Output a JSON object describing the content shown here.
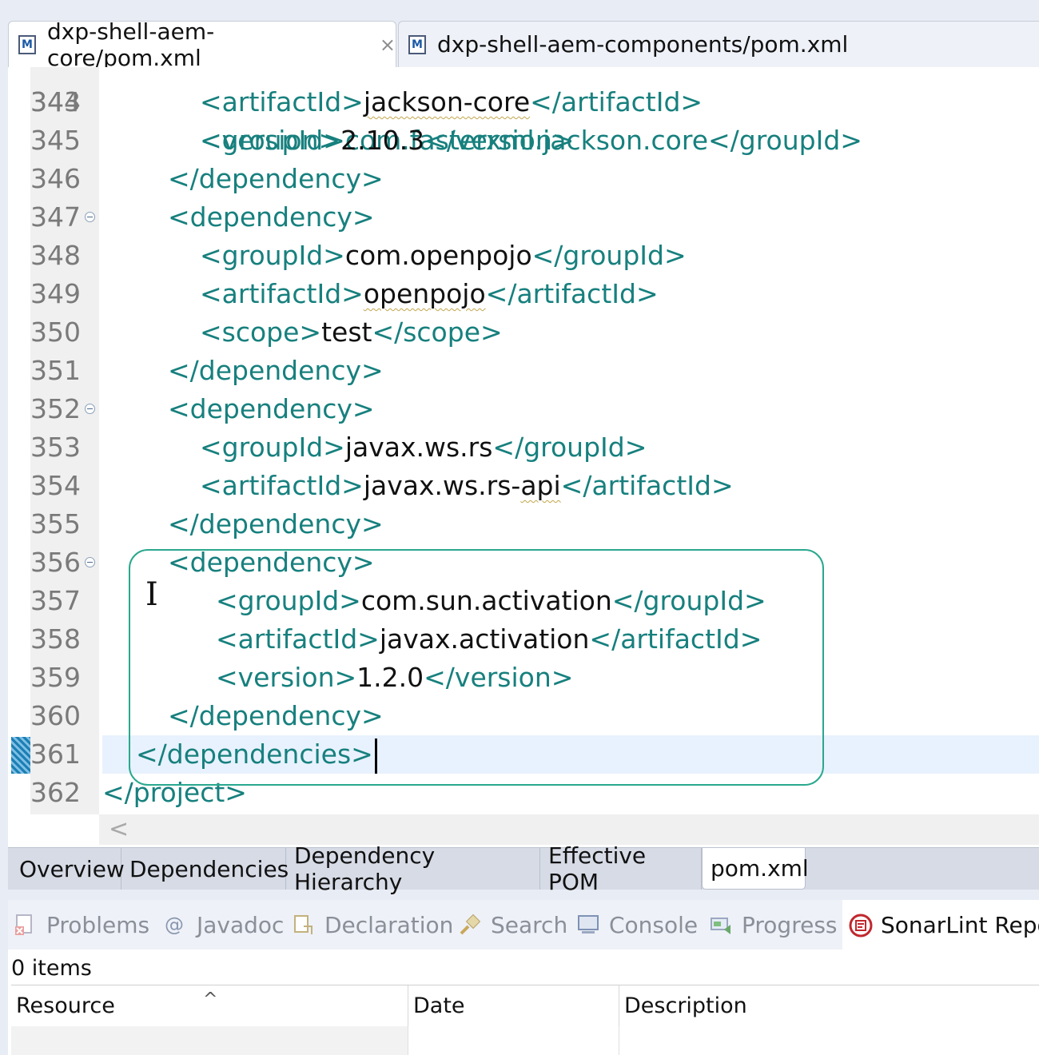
{
  "tabs": [
    {
      "label": "dxp-shell-aem-core/pom.xml",
      "active": true
    },
    {
      "label": "dxp-shell-aem-components/pom.xml",
      "active": false
    }
  ],
  "tab_icon_letter": "M",
  "editor": {
    "partial_line_text": "<groupId>com.fasterxml.jackson.core</groupId>",
    "lines": [
      {
        "n": "344",
        "indent": 3,
        "parts": [
          [
            "t",
            "<artifactId>"
          ],
          [
            "x",
            "jackson-core",
            "s"
          ],
          [
            "t",
            "</artifactId>"
          ]
        ]
      },
      {
        "n": "345",
        "indent": 3,
        "parts": [
          [
            "t",
            "<version>"
          ],
          [
            "x",
            "2.10.3"
          ],
          [
            "t",
            "</version>"
          ]
        ]
      },
      {
        "n": "346",
        "indent": 2,
        "parts": [
          [
            "t",
            "</dependency>"
          ]
        ]
      },
      {
        "n": "347",
        "indent": 2,
        "fold": true,
        "parts": [
          [
            "t",
            "<dependency>"
          ]
        ]
      },
      {
        "n": "348",
        "indent": 3,
        "parts": [
          [
            "t",
            "<groupId>"
          ],
          [
            "x",
            "com.openpojo"
          ],
          [
            "t",
            "</groupId>"
          ]
        ]
      },
      {
        "n": "349",
        "indent": 3,
        "parts": [
          [
            "t",
            "<artifactId>"
          ],
          [
            "x",
            "openpojo",
            "s"
          ],
          [
            "t",
            "</artifactId>"
          ]
        ]
      },
      {
        "n": "350",
        "indent": 3,
        "parts": [
          [
            "t",
            "<scope>"
          ],
          [
            "x",
            "test"
          ],
          [
            "t",
            "</scope>"
          ]
        ]
      },
      {
        "n": "351",
        "indent": 2,
        "parts": [
          [
            "t",
            "</dependency>"
          ]
        ]
      },
      {
        "n": "352",
        "indent": 2,
        "fold": true,
        "parts": [
          [
            "t",
            "<dependency>"
          ]
        ]
      },
      {
        "n": "353",
        "indent": 3,
        "parts": [
          [
            "t",
            "<groupId>"
          ],
          [
            "x",
            "javax.ws.rs"
          ],
          [
            "t",
            "</groupId>"
          ]
        ]
      },
      {
        "n": "354",
        "indent": 3,
        "parts": [
          [
            "t",
            "<artifactId>"
          ],
          [
            "x",
            "javax.ws.rs-"
          ],
          [
            "x",
            "api",
            "s"
          ],
          [
            "t",
            "</artifactId>"
          ]
        ]
      },
      {
        "n": "355",
        "indent": 2,
        "parts": [
          [
            "t",
            "</dependency>"
          ]
        ]
      },
      {
        "n": "356",
        "indent": 2,
        "fold": true,
        "parts": [
          [
            "t",
            "<dependency>"
          ]
        ]
      },
      {
        "n": "357",
        "indent": 4,
        "parts": [
          [
            "t",
            "<groupId>"
          ],
          [
            "x",
            "com.sun.activation"
          ],
          [
            "t",
            "</groupId>"
          ]
        ]
      },
      {
        "n": "358",
        "indent": 4,
        "parts": [
          [
            "t",
            "<artifactId>"
          ],
          [
            "x",
            "javax.activation"
          ],
          [
            "t",
            "</artifactId>"
          ]
        ]
      },
      {
        "n": "359",
        "indent": 4,
        "parts": [
          [
            "t",
            "<version>"
          ],
          [
            "x",
            "1.2.0"
          ],
          [
            "t",
            "</version>"
          ]
        ]
      },
      {
        "n": "360",
        "indent": 2,
        "parts": [
          [
            "t",
            "</dependency>"
          ]
        ]
      },
      {
        "n": "361",
        "indent": 1,
        "current": true,
        "caret": true,
        "parts": [
          [
            "t",
            "</dependencies>"
          ]
        ]
      },
      {
        "n": "362",
        "indent": 0,
        "parts": [
          [
            "t",
            "</project>"
          ]
        ]
      }
    ]
  },
  "page_tabs": [
    {
      "label": "Overview",
      "active": false
    },
    {
      "label": "Dependencies",
      "active": false
    },
    {
      "label": "Dependency Hierarchy",
      "active": false
    },
    {
      "label": "Effective POM",
      "active": false
    },
    {
      "label": "pom.xml",
      "active": true
    }
  ],
  "view_tabs": [
    {
      "label": "Problems",
      "icon": "problems-icon",
      "active": false
    },
    {
      "label": "Javadoc",
      "icon": "javadoc-icon",
      "active": false
    },
    {
      "label": "Declaration",
      "icon": "declaration-icon",
      "active": false
    },
    {
      "label": "Search",
      "icon": "search-icon",
      "active": false
    },
    {
      "label": "Console",
      "icon": "console-icon",
      "active": false
    },
    {
      "label": "Progress",
      "icon": "progress-icon",
      "active": false
    },
    {
      "label": "SonarLint Repo",
      "icon": "sonarlint-icon",
      "active": true
    }
  ],
  "panel": {
    "items_count": "0 items",
    "columns": [
      "Resource",
      "Date",
      "Description"
    ]
  },
  "colors": {
    "tag": "#17807e",
    "text": "#111111",
    "highlight_box": "#2aa88e",
    "current_line": "#e8f2fe"
  }
}
